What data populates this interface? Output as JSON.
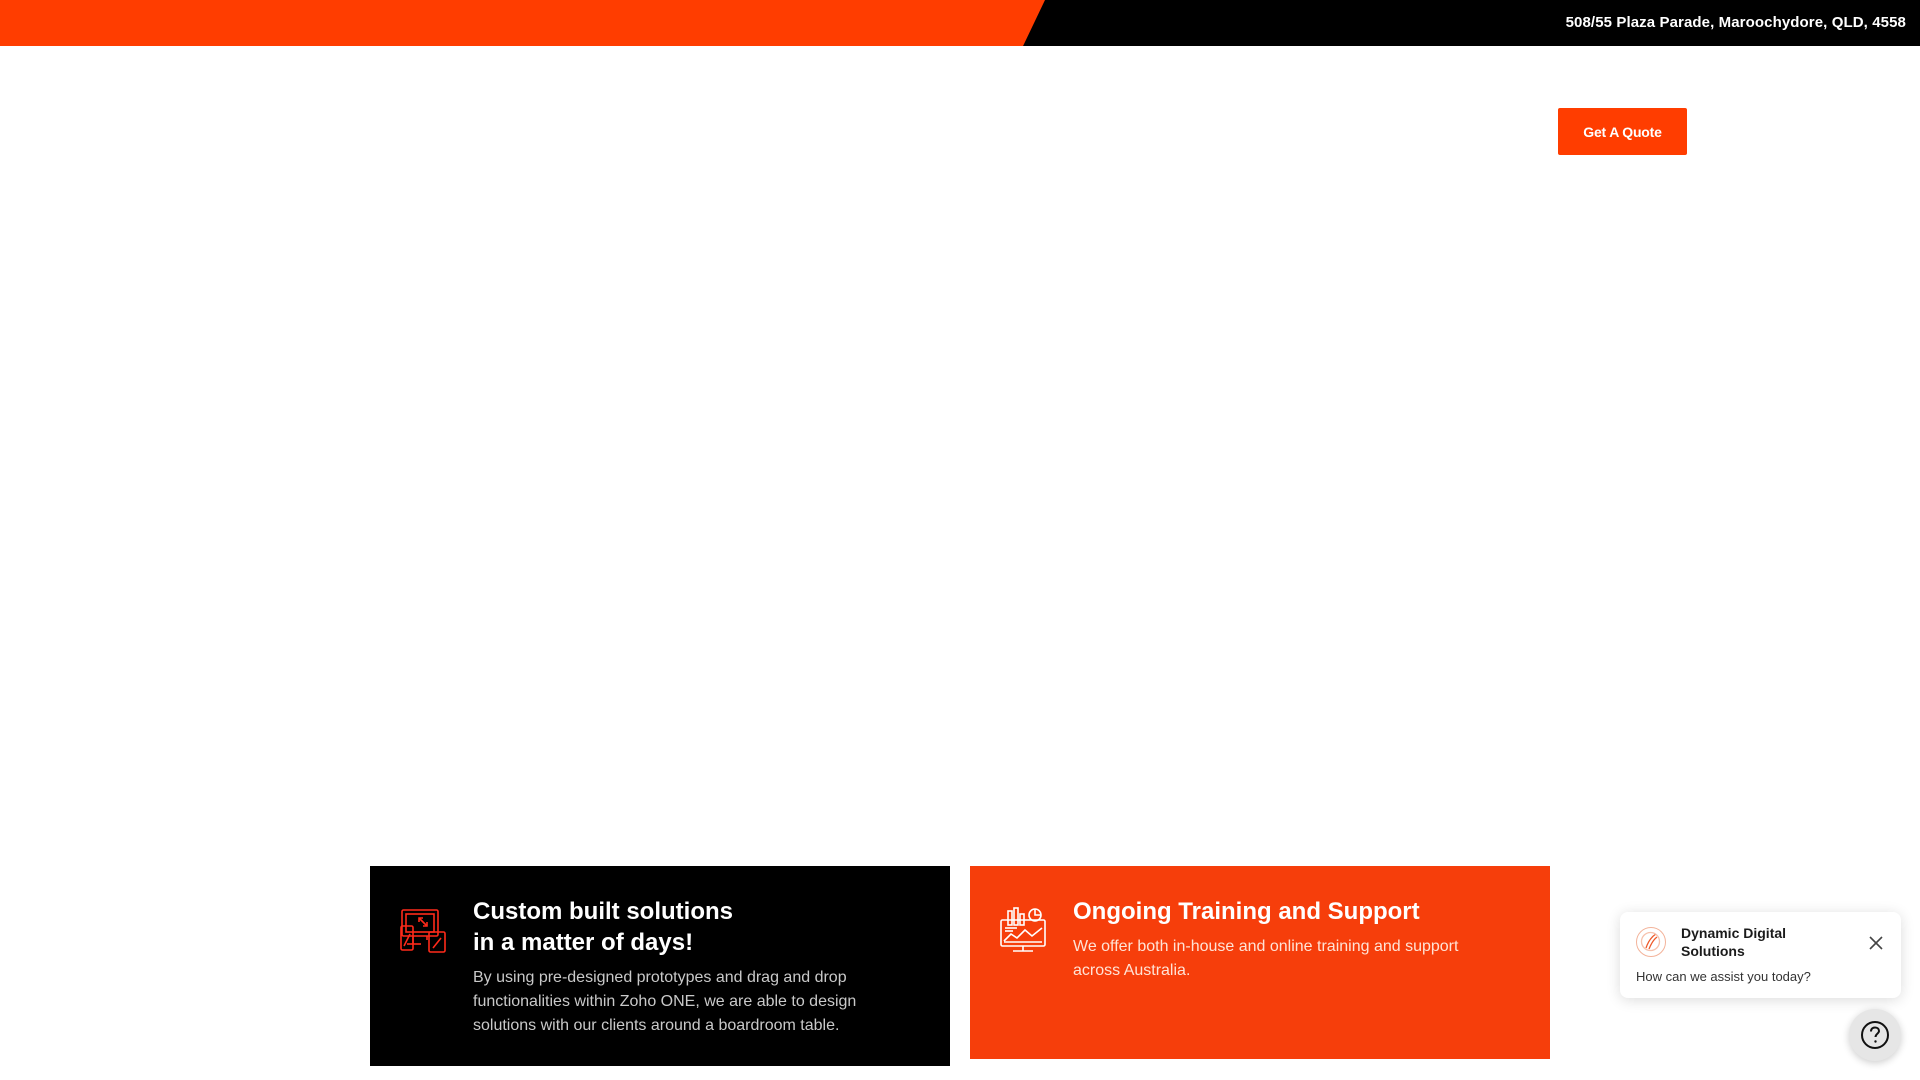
{
  "topbar": {
    "address": "508/55 Plaza Parade, Maroochydore, QLD, 4558"
  },
  "header": {
    "quote_label": "Get A Quote"
  },
  "features": [
    {
      "title": "Custom built solutions\nin a matter of days!",
      "text": "By using pre-designed prototypes and drag and drop functionalities within Zoho ONE, we are able to design solutions with our clients around a boardroom table.",
      "icon": "devices-icon"
    },
    {
      "title": "Ongoing Training and Support",
      "text": "We offer both in-house and online training and support across Australia.",
      "icon": "monitor-chart-icon"
    }
  ],
  "chat": {
    "company": "Dynamic Digital Solutions",
    "message": "How can we assist you today?"
  },
  "colors": {
    "brand_orange": "#ff3d00",
    "card_orange": "#f63e0b",
    "black": "#000000"
  }
}
